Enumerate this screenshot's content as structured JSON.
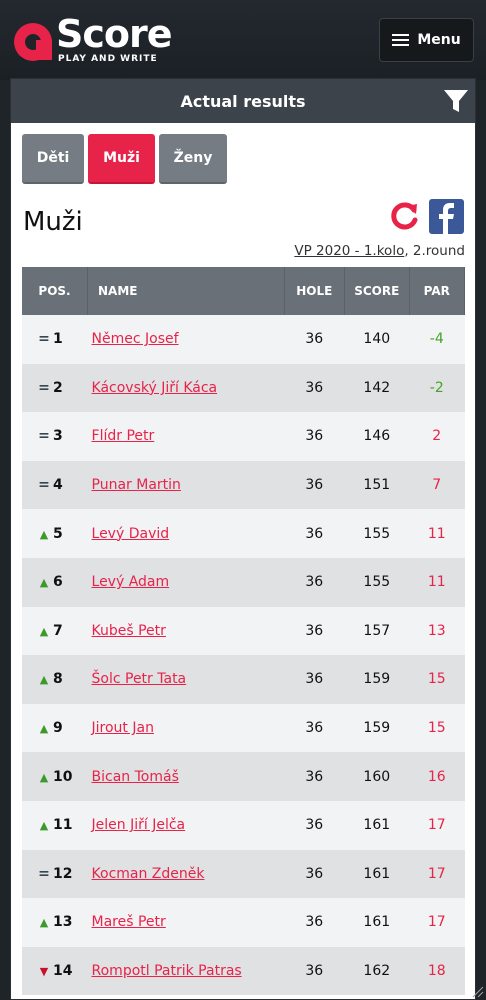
{
  "brand": {
    "name": "Score",
    "tagline": "PLAY AND WRITE",
    "accent": "#e8234a"
  },
  "menu": {
    "label": "Menu"
  },
  "panel": {
    "title": "Actual results"
  },
  "tabs": [
    {
      "label": "Děti",
      "active": false
    },
    {
      "label": "Muži",
      "active": true
    },
    {
      "label": "Ženy",
      "active": false
    }
  ],
  "section": {
    "title": "Muži",
    "round_link": "VP 2020 - 1.kolo",
    "round_suffix": ", 2.round"
  },
  "table": {
    "headers": {
      "pos": "POS.",
      "name": "NAME",
      "hole": "HOLE",
      "score": "SCORE",
      "par": "PAR"
    },
    "rows": [
      {
        "trend": "eq",
        "pos": "1",
        "name": "Němec Josef",
        "hole": "36",
        "score": "140",
        "par": "-4"
      },
      {
        "trend": "eq",
        "pos": "2",
        "name": "Kácovský Jiří Káca",
        "hole": "36",
        "score": "142",
        "par": "-2"
      },
      {
        "trend": "eq",
        "pos": "3",
        "name": "Flídr Petr",
        "hole": "36",
        "score": "146",
        "par": "2"
      },
      {
        "trend": "eq",
        "pos": "4",
        "name": "Punar Martin",
        "hole": "36",
        "score": "151",
        "par": "7"
      },
      {
        "trend": "up",
        "pos": "5",
        "name": "Levý David",
        "hole": "36",
        "score": "155",
        "par": "11"
      },
      {
        "trend": "up",
        "pos": "6",
        "name": "Levý Adam",
        "hole": "36",
        "score": "155",
        "par": "11"
      },
      {
        "trend": "up",
        "pos": "7",
        "name": "Kubeš Petr",
        "hole": "36",
        "score": "157",
        "par": "13"
      },
      {
        "trend": "up",
        "pos": "8",
        "name": "Šolc Petr Tata",
        "hole": "36",
        "score": "159",
        "par": "15"
      },
      {
        "trend": "up",
        "pos": "9",
        "name": "Jirout Jan",
        "hole": "36",
        "score": "159",
        "par": "15"
      },
      {
        "trend": "up",
        "pos": "10",
        "name": "Bican Tomáš",
        "hole": "36",
        "score": "160",
        "par": "16"
      },
      {
        "trend": "up",
        "pos": "11",
        "name": "Jelen Jiří Jelča",
        "hole": "36",
        "score": "161",
        "par": "17"
      },
      {
        "trend": "eq",
        "pos": "12",
        "name": "Kocman Zdeněk",
        "hole": "36",
        "score": "161",
        "par": "17"
      },
      {
        "trend": "up",
        "pos": "13",
        "name": "Mareš Petr",
        "hole": "36",
        "score": "161",
        "par": "17"
      },
      {
        "trend": "down",
        "pos": "14",
        "name": "Rompotl Patrik Patras",
        "hole": "36",
        "score": "162",
        "par": "18"
      }
    ]
  },
  "icons": {
    "filter": "filter-icon",
    "refresh": "refresh-icon",
    "facebook": "facebook-icon",
    "menu": "hamburger-icon",
    "trend_eq": "equal-icon",
    "trend_up": "arrow-up-icon",
    "trend_down": "arrow-down-icon"
  },
  "colors": {
    "header_bg": "#3c434b",
    "table_head_bg": "#6a7078",
    "par_negative": "#44a32a",
    "par_positive": "#e8234a",
    "facebook": "#3b5998"
  }
}
